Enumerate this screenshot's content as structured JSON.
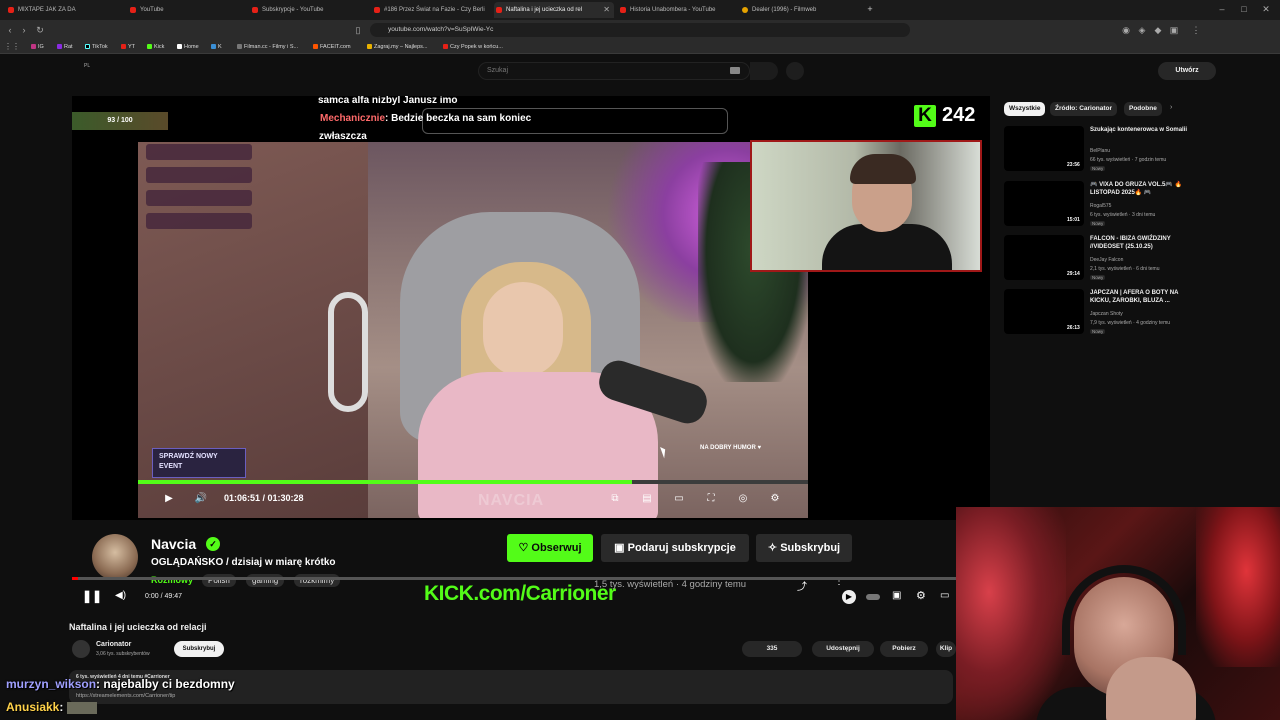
{
  "browser": {
    "tabs": [
      {
        "title": "MIXTAPE JAK ZA DA",
        "active": false
      },
      {
        "title": "YouTube",
        "active": false
      },
      {
        "title": "Subskrypcje - YouTube",
        "active": false
      },
      {
        "title": "#186 Przez Świat na Fazie - Czy Berli",
        "active": false
      },
      {
        "title": "Naftalina i jej ucieczka od rel",
        "active": true
      },
      {
        "title": "Historia Unabombera - YouTube",
        "active": false
      },
      {
        "title": "Dealer (1996) - Filmweb",
        "active": false
      }
    ],
    "url": "youtube.com/watch?v=SuSpIWie-Yc",
    "bookmarks": [
      "IG",
      "Rat",
      "TikTok",
      "YT",
      "Kick",
      "Home",
      "K",
      "Filman.cc - Filmy i S...",
      "FACEIT.com",
      "Zagraj.my – Najleps...",
      "Czy Popek w końcu..."
    ],
    "bookmark_pl": "PL"
  },
  "youtube_header": {
    "search_placeholder": "Szukaj",
    "create_label": "Utwórz"
  },
  "kick_stream": {
    "chat_lines": [
      {
        "user": "",
        "text": "samca alfa nizbyl Janusz imo"
      },
      {
        "user": "Mechanicznie",
        "text": ": Bedzie beczka na sam koniec"
      },
      {
        "user": "",
        "text": "zwłaszcza"
      }
    ],
    "badge": "93 / 100",
    "viewers": "242",
    "event_text": "SPRAWDŹ NOWY EVENT",
    "time": "01:06:51 / 01:30:28",
    "progress": 0.737,
    "overlay_label": "NAVCIA",
    "humor_text": "NA DOBRY HUMOR ♥"
  },
  "kick_channel": {
    "name": "Navcia",
    "title": "OGLĄDAŃSKO / dzisiaj w miarę krótko",
    "category": "Rozmowy",
    "tags": [
      "Polish",
      "gaming",
      "rozkmimy"
    ],
    "follow_label": "Obserwuj",
    "gift_label": "Podaruj subskrypcje",
    "sub_label": "Subskrybuj",
    "promo": "KICK.com/Carrioner",
    "meta": "1,5 tys. wyświetleń  ·  4 godziny temu"
  },
  "yt_player": {
    "time": "0:00 / 49:47",
    "progress": 0.007
  },
  "video": {
    "title": "Naftalina i jej ucieczka od relacji",
    "channel": "Carionator",
    "subs": "3,06 tys. subskrybentów",
    "subscribe_label": "Subskrybuj",
    "likes": "335",
    "share_label": "Udostępnij",
    "download_label": "Pobierz",
    "clip_label": "Klip",
    "desc_line": "6 tys. wyświetleń  4 dni temu  #Carrioner",
    "desc_link": "https://streamelements.com/Carrioner/tip"
  },
  "overlay_chat": [
    {
      "user": "murzyn_wikson",
      "text": ": najebalby ci bezdomny"
    },
    {
      "user": "Anusiakk",
      "text": ":"
    }
  ],
  "sidebar": {
    "chips": [
      "Wszystkie",
      "Źródło: Carionator",
      "Podobne"
    ],
    "recommendations": [
      {
        "title": "Szukając kontenerowca w Somalii",
        "channel": "BelPlanu",
        "meta": "66 tys. wyświetleń · 7 godzin temu",
        "badge": "Nowy",
        "duration": "23:56"
      },
      {
        "title": "🎮 VIXA DO GRUZA VOL.5🎮 🔥 LISTOPAD 2025🔥 🎮",
        "channel": "Rogal575",
        "meta": "6 tys. wyświetleń · 3 dni temu",
        "badge": "Nowy",
        "duration": "15:01"
      },
      {
        "title": "FALCON - IBIZA GWIŹDZINY //VIDEOSET (25.10.25)",
        "channel": "DeeJay Falcon",
        "meta": "2,1 tys. wyświetleń · 6 dni temu",
        "badge": "Nowy",
        "duration": "29:14"
      },
      {
        "title": "JAPCZAN | AFERA O BOTY NA KICKU, ZAROBKI, BLUZA ...",
        "channel": "Japczan Shoty",
        "meta": "7,9 tys. wyświetleń · 4 godziny temu",
        "badge": "Nowy",
        "duration": "26:13"
      }
    ]
  }
}
